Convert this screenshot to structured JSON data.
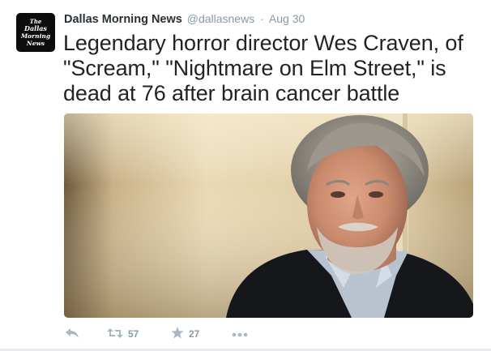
{
  "tweet": {
    "author_name": "Dallas Morning News",
    "handle": "@dallasnews",
    "separator": "·",
    "time": "Aug 30",
    "text": "Legendary horror director Wes Craven, of \"Scream,\" \"Nightmare on Elm Street,\" is dead at 76 after brain cancer battle",
    "avatar_logo_text": "The Dallas Morning News",
    "avatar_bg": "#0d0d0d"
  },
  "actions": {
    "reply_icon": "reply-icon",
    "retweet_icon": "retweet-icon",
    "retweet_count": "57",
    "favorite_icon": "star-icon",
    "favorite_count": "27",
    "more_icon": "more-dots-icon"
  },
  "colors": {
    "text": "#1f2326",
    "meta": "#8899a6",
    "action_icon": "#aab8c2"
  }
}
